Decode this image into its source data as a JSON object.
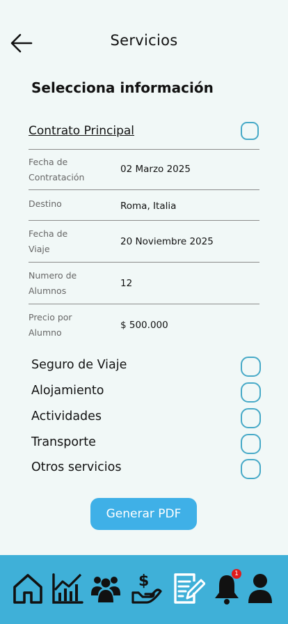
{
  "header": {
    "title": "Servicios",
    "back_icon": "arrow-left-icon"
  },
  "section_title": "Selecciona información",
  "contract": {
    "label": "Contrato Principal",
    "checked": false
  },
  "details": [
    {
      "label_line1": "Fecha de",
      "label_line2": "Contratación",
      "value": "02 Marzo 2025"
    },
    {
      "label_line1": "Destino",
      "label_line2": "",
      "value": "Roma, Italia"
    },
    {
      "label_line1": "Fecha de",
      "label_line2": "Viaje",
      "value": "20 Noviembre 2025"
    },
    {
      "label_line1": "Numero de",
      "label_line2": "Alumnos",
      "value": "12"
    },
    {
      "label_line1": "Precio por",
      "label_line2": "Alumno",
      "value": "$ 500.000"
    }
  ],
  "services": [
    {
      "label": "Seguro de Viaje",
      "checked": false
    },
    {
      "label": "Alojamiento",
      "checked": false
    },
    {
      "label": "Actividades",
      "checked": false
    },
    {
      "label": "Transporte",
      "checked": false
    },
    {
      "label": "Otros servicios",
      "checked": false
    }
  ],
  "pdf_button": {
    "label": "Generar PDF"
  },
  "nav": {
    "items": [
      "home-icon",
      "chart-icon",
      "group-icon",
      "payment-icon",
      "document-edit-icon",
      "bell-icon",
      "user-icon"
    ],
    "notification_count": "1"
  },
  "colors": {
    "accent": "#3fb0e7",
    "navbar": "#3fb0d8",
    "checkbox": "#46a9c7",
    "badge": "#e01c1c",
    "background": "#f1f8f7"
  }
}
